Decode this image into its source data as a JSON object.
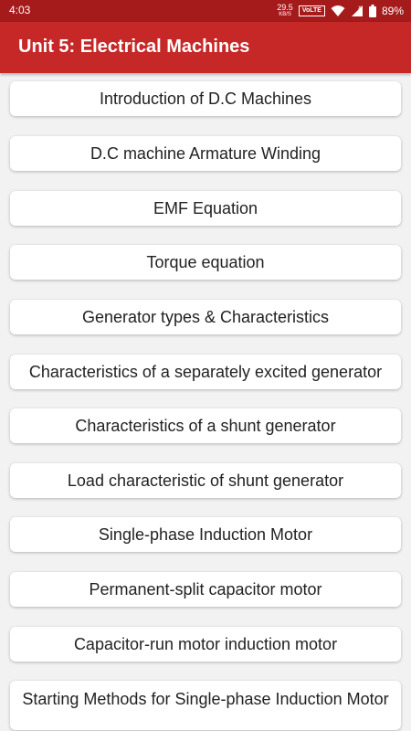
{
  "status_bar": {
    "time": "4:03",
    "speed_value": "29.5",
    "speed_unit": "KB/S",
    "volte": "VoLTE",
    "battery": "89%"
  },
  "app_bar": {
    "title": "Unit 5: Electrical Machines"
  },
  "topics": [
    "Introduction of D.C Machines",
    "D.C machine Armature Winding",
    "EMF Equation",
    "Torque equation",
    "Generator types & Characteristics",
    "Characteristics of a separately excited generator",
    "Characteristics of a shunt generator",
    "Load characteristic of shunt generator",
    "Single-phase Induction Motor",
    "Permanent-split capacitor motor",
    "Capacitor-run motor induction motor",
    "Starting Methods for Single-phase Induction Motor"
  ],
  "colors": {
    "status_bar": "#a51a1a",
    "app_bar": "#c62828",
    "background": "#f2f2f2"
  },
  "icons": [
    "wifi-icon",
    "signal-icon",
    "battery-icon"
  ]
}
